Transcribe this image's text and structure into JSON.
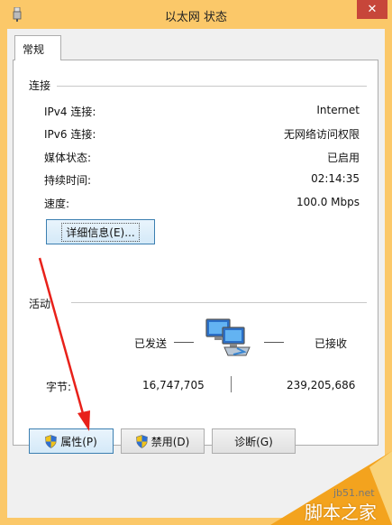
{
  "window": {
    "title": "以太网 状态",
    "close_label": "✕"
  },
  "tabs": [
    {
      "label": "常规"
    }
  ],
  "connection": {
    "group_label": "连接",
    "rows": [
      {
        "label": "IPv4 连接:",
        "value": "Internet"
      },
      {
        "label": "IPv6 连接:",
        "value": "无网络访问权限"
      },
      {
        "label": "媒体状态:",
        "value": "已启用"
      },
      {
        "label": "持续时间:",
        "value": "02:14:35"
      },
      {
        "label": "速度:",
        "value": "100.0 Mbps"
      }
    ],
    "details_button": "详细信息(E)..."
  },
  "activity": {
    "group_label": "活动",
    "sent_label": "已发送",
    "received_label": "已接收",
    "bytes_label": "字节:",
    "bytes_sent": "16,747,705",
    "bytes_received": "239,205,686"
  },
  "footer_buttons": {
    "properties": "属性(P)",
    "disable": "禁用(D)",
    "diagnose": "诊断(G)"
  },
  "watermark": {
    "site": "jb51.net",
    "cn": "脚本之家"
  },
  "colors": {
    "titlebar": "#fbc869",
    "close": "#c7463a",
    "arrow": "#e8211a"
  }
}
